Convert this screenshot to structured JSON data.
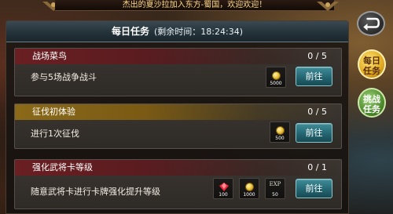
{
  "banner": {
    "text": "杰出的夏沙拉加入东方-蜀国，欢迎欢迎！"
  },
  "header": {
    "title": "每日任务",
    "timer": "(剩余时间：18:24:34)"
  },
  "tasks": [
    {
      "name": "战场菜鸟",
      "progress": "0 / 5",
      "description": "参与5场战争战斗",
      "rewards": [
        {
          "type": "coin-icon",
          "value": "5000"
        }
      ],
      "button": "前往"
    },
    {
      "name": "征伐初体验",
      "progress": "0 / 5",
      "description": "进行1次征伐",
      "rewards": [
        {
          "type": "coin-icon",
          "value": "500"
        }
      ],
      "button": "前往"
    },
    {
      "name": "强化武将卡等级",
      "progress": "0 / 1",
      "description": "随意武将卡进行卡牌强化提升等级",
      "rewards": [
        {
          "type": "ruby-icon",
          "value": "100"
        },
        {
          "type": "coin-icon",
          "value": "1000"
        },
        {
          "type": "exp-icon",
          "label": "EXP",
          "value": "50"
        }
      ],
      "button": "前往"
    }
  ],
  "side": {
    "daily": "每日\n任务",
    "challenge": "挑战\n任务",
    "daily_line1": "每日",
    "daily_line2": "任务",
    "challenge_line1": "挑战",
    "challenge_line2": "任务"
  },
  "colors": {
    "accent_teal": "#246672",
    "task_red": "#6a1f22",
    "task_gold": "#8a6a18",
    "daily_gold": "#e0a820",
    "challenge_green": "#4f8c2e"
  }
}
